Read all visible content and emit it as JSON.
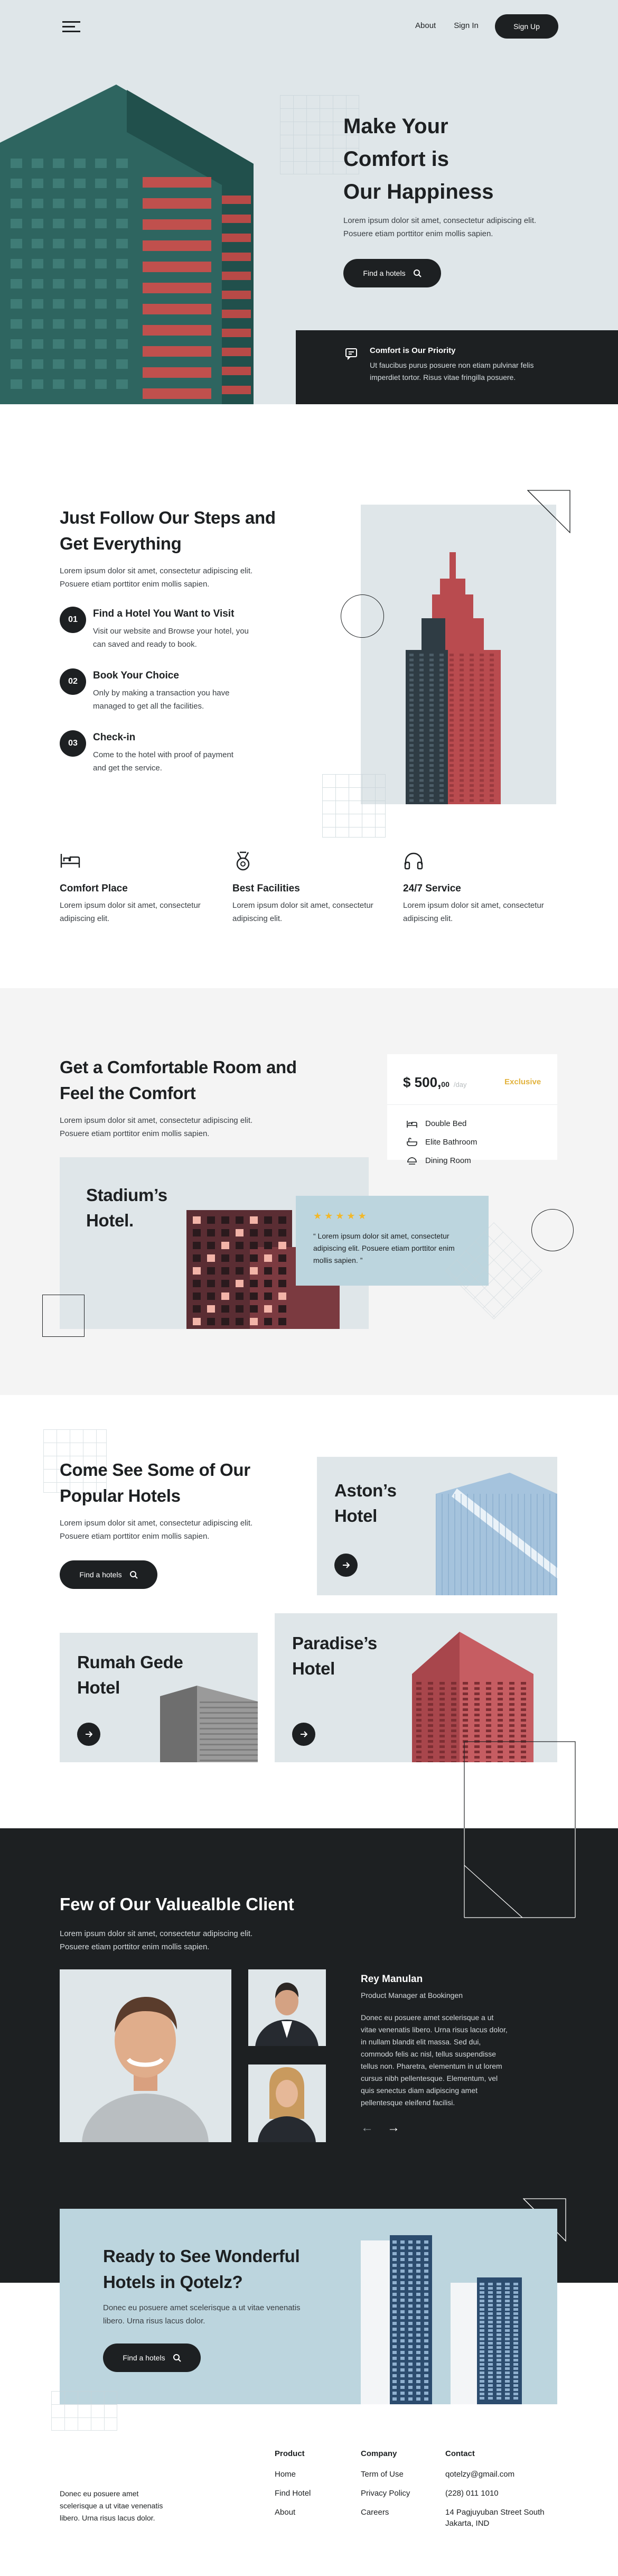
{
  "nav": {
    "about": "About",
    "signin": "Sign In",
    "signup": "Sign Up"
  },
  "hero": {
    "title_l1": "Make Your",
    "title_l2": "Comfort is",
    "title_l3": "Our Happiness",
    "desc_l1": "Lorem ipsum dolor sit amet, consectetur adipiscing elit.",
    "desc_l2": "Posuere etiam porttitor enim mollis sapien.",
    "cta": "Find a hotels",
    "priority_title": "Comfort is Our Priority",
    "priority_l1": "Ut faucibus purus posuere non etiam pulvinar felis",
    "priority_l2": "imperdiet tortor. Risus vitae fringilla posuere."
  },
  "steps": {
    "title_l1": "Just Follow Our Steps and",
    "title_l2": "Get Everything",
    "desc_l1": "Lorem ipsum dolor sit amet, consectetur adipiscing elit.",
    "desc_l2": "Posuere etiam porttitor enim mollis sapien.",
    "items": [
      {
        "num": "01",
        "title": "Find a Hotel You Want to Visit",
        "l1": "Visit our website and Browse your hotel, you",
        "l2": "can saved and ready to book."
      },
      {
        "num": "02",
        "title": "Book Your Choice",
        "l1": "Only by making a transaction you have",
        "l2": "managed to get all the facilities."
      },
      {
        "num": "03",
        "title": "Check-in",
        "l1": "Come to the hotel with proof of payment",
        "l2": "and get the service."
      }
    ]
  },
  "features": [
    {
      "icon": "bed-icon",
      "title": "Comfort Place",
      "l1": "Lorem ipsum dolor sit amet, consectetur",
      "l2": "adipiscing elit."
    },
    {
      "icon": "medal-icon",
      "title": "Best Facilities",
      "l1": "Lorem ipsum dolor sit amet, consectetur",
      "l2": "adipiscing elit."
    },
    {
      "icon": "headphones-icon",
      "title": "24/7 Service",
      "l1": "Lorem ipsum dolor sit amet, consectetur",
      "l2": "adipiscing elit."
    }
  ],
  "room": {
    "title_l1": "Get a Comfortable Room and",
    "title_l2": "Feel the Comfort",
    "desc_l1": "Lorem ipsum dolor sit amet, consectetur adipiscing elit.",
    "desc_l2": "Posuere etiam porttitor enim mollis sapien.",
    "hotel_l1": "Stadium’s",
    "hotel_l2": "Hotel.",
    "rating": "★ ★ ★ ★ ★",
    "review_l1": "“ Lorem ipsum dolor sit amet, consectetur",
    "review_l2": "adipiscing elit. Posuere etiam porttitor enim",
    "review_l3": "mollis sapien. ”",
    "price": "$ 500,",
    "cents": "00",
    "per": "/day",
    "badge": "Exclusive",
    "amenities": [
      "Double Bed",
      "Elite Bathroom",
      "Dining Room"
    ]
  },
  "popular": {
    "title_l1": "Come See Some of Our",
    "title_l2": "Popular Hotels",
    "desc_l1": "Lorem ipsum dolor sit amet, consectetur adipiscing elit.",
    "desc_l2": "Posuere etiam porttitor enim mollis sapien.",
    "cta": "Find a hotels",
    "hotels": [
      {
        "l1": "Aston’s",
        "l2": "Hotel"
      },
      {
        "l1": "Rumah Gede",
        "l2": "Hotel"
      },
      {
        "l1": "Paradise’s",
        "l2": "Hotel"
      }
    ]
  },
  "clients": {
    "title": "Few of Our Valuealble Client",
    "desc_l1": "Lorem ipsum dolor sit amet, consectetur adipiscing elit.",
    "desc_l2": "Posuere etiam porttitor enim mollis sapien.",
    "name": "Rey Manulan",
    "role": "Product Manager at Bookingen",
    "quote": [
      "Donec eu posuere amet scelerisque a ut",
      "vitae venenatis libero. Urna risus lacus dolor,",
      "in nullam blandit elit massa. Sed dui,",
      "commodo felis ac nisl, tellus suspendisse",
      "tellus non. Pharetra, elementum in ut lorem",
      "cursus nibh pellentesque. Elementum, vel",
      "quis senectus diam adipiscing amet",
      "pellentesque eleifend facilisi."
    ],
    "prev": "←",
    "next": "→"
  },
  "cta": {
    "title_l1": "Ready to See Wonderful",
    "title_l2": "Hotels in Qotelz?",
    "desc_l1": "Donec eu posuere amet scelerisque a ut vitae venenatis",
    "desc_l2": "libero. Urna risus lacus dolor.",
    "button": "Find a hotels"
  },
  "footer": {
    "about": [
      "Donec eu posuere amet",
      "scelerisque a ut vitae venenatis",
      "libero. Urna risus lacus dolor."
    ],
    "product": {
      "title": "Product",
      "links": [
        "Home",
        "Find Hotel",
        "About"
      ]
    },
    "company": {
      "title": "Company",
      "links": [
        "Term of Use",
        "Privacy Policy",
        "Careers"
      ]
    },
    "contact": {
      "title": "Contact",
      "links": [
        "qotelzy@gmail.com",
        "(228) 011 1010",
        "14 Pagjuyuban Street South",
        "Jakarta, IND"
      ]
    }
  }
}
